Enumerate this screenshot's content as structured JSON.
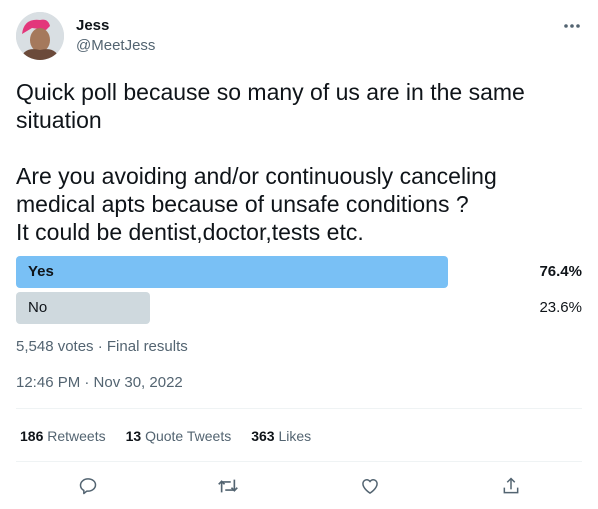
{
  "author": {
    "name": "Jess",
    "handle": "@MeetJess"
  },
  "tweet": {
    "text": "Quick poll because so many of us are in the same situation\n\nAre you avoiding and/or continuously canceling medical apts because of unsafe conditions ?\nIt could be dentist,doctor,tests etc."
  },
  "poll": {
    "options": [
      {
        "label": "Yes",
        "percent_text": "76.4%",
        "percent": 76.4,
        "winner": true
      },
      {
        "label": "No",
        "percent_text": "23.6%",
        "percent": 23.6,
        "winner": false
      }
    ],
    "summary": "5,548 votes · Final results"
  },
  "timestamp": "12:46 PM · Nov 30, 2022",
  "stats": {
    "retweets": {
      "count": "186",
      "label": "Retweets"
    },
    "quotes": {
      "count": "13",
      "label": "Quote Tweets"
    },
    "likes": {
      "count": "363",
      "label": "Likes"
    }
  },
  "icons": [
    "more-icon",
    "reply-icon",
    "retweet-icon",
    "like-icon",
    "share-icon"
  ],
  "colors": {
    "poll_winner": "#79c0f5",
    "poll_loser": "#cfd9de",
    "secondary_text": "#536471"
  }
}
